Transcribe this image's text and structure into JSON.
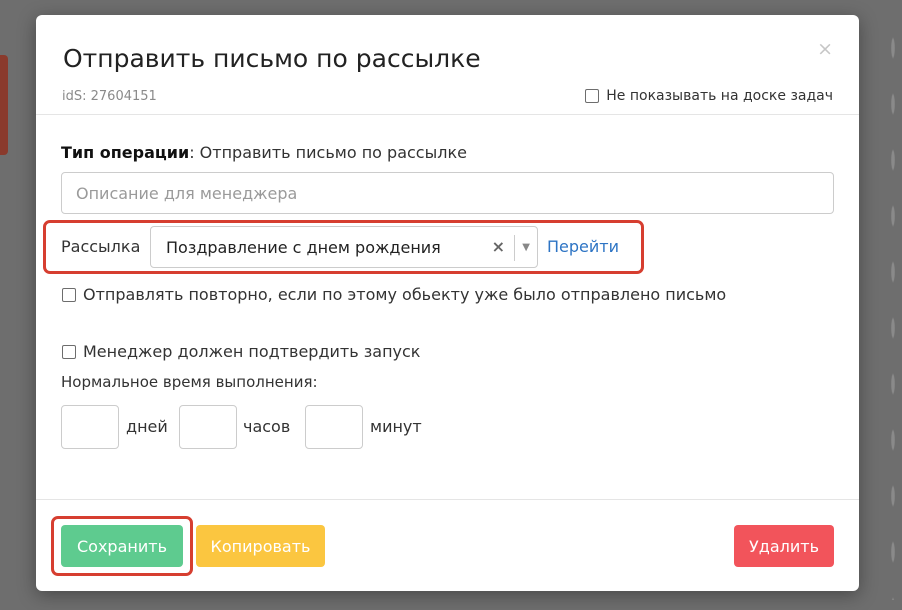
{
  "modal": {
    "title": "Отправить письмо по рассылке",
    "close_symbol": "×",
    "ids_text": "idS: 27604151",
    "hide_on_board_label": "Не показывать на доске задач"
  },
  "operation": {
    "type_label": "Тип операции",
    "type_value": ": Отправить письмо по рассылке"
  },
  "description_input": {
    "placeholder": "Описание для менеджера",
    "value": ""
  },
  "mailing": {
    "label": "Рассылка",
    "selected": "Поздравление с днем рождения",
    "clear_symbol": "×",
    "arrow_symbol": "▼",
    "goto_label": "Перейти"
  },
  "options": {
    "resend_label": "Отправлять повторно, если по этому обьекту уже было отправлено письмо",
    "confirm_label": "Менеджер должен подтвердить запуск"
  },
  "duration": {
    "title": "Нормальное время выполнения:",
    "days_label": "дней",
    "hours_label": "часов",
    "minutes_label": "минут",
    "days_value": "",
    "hours_value": "",
    "minutes_value": ""
  },
  "footer": {
    "save_label": "Сохранить",
    "copy_label": "Копировать",
    "delete_label": "Удалить"
  },
  "colors": {
    "save": "#5ecb8f",
    "copy": "#fbc640",
    "delete": "#f2545b",
    "link": "#2d74c4",
    "highlight": "#d63e30"
  },
  "icons": {
    "close": "close-icon",
    "clear": "clear-icon",
    "dropdown": "chevron-down-icon"
  }
}
